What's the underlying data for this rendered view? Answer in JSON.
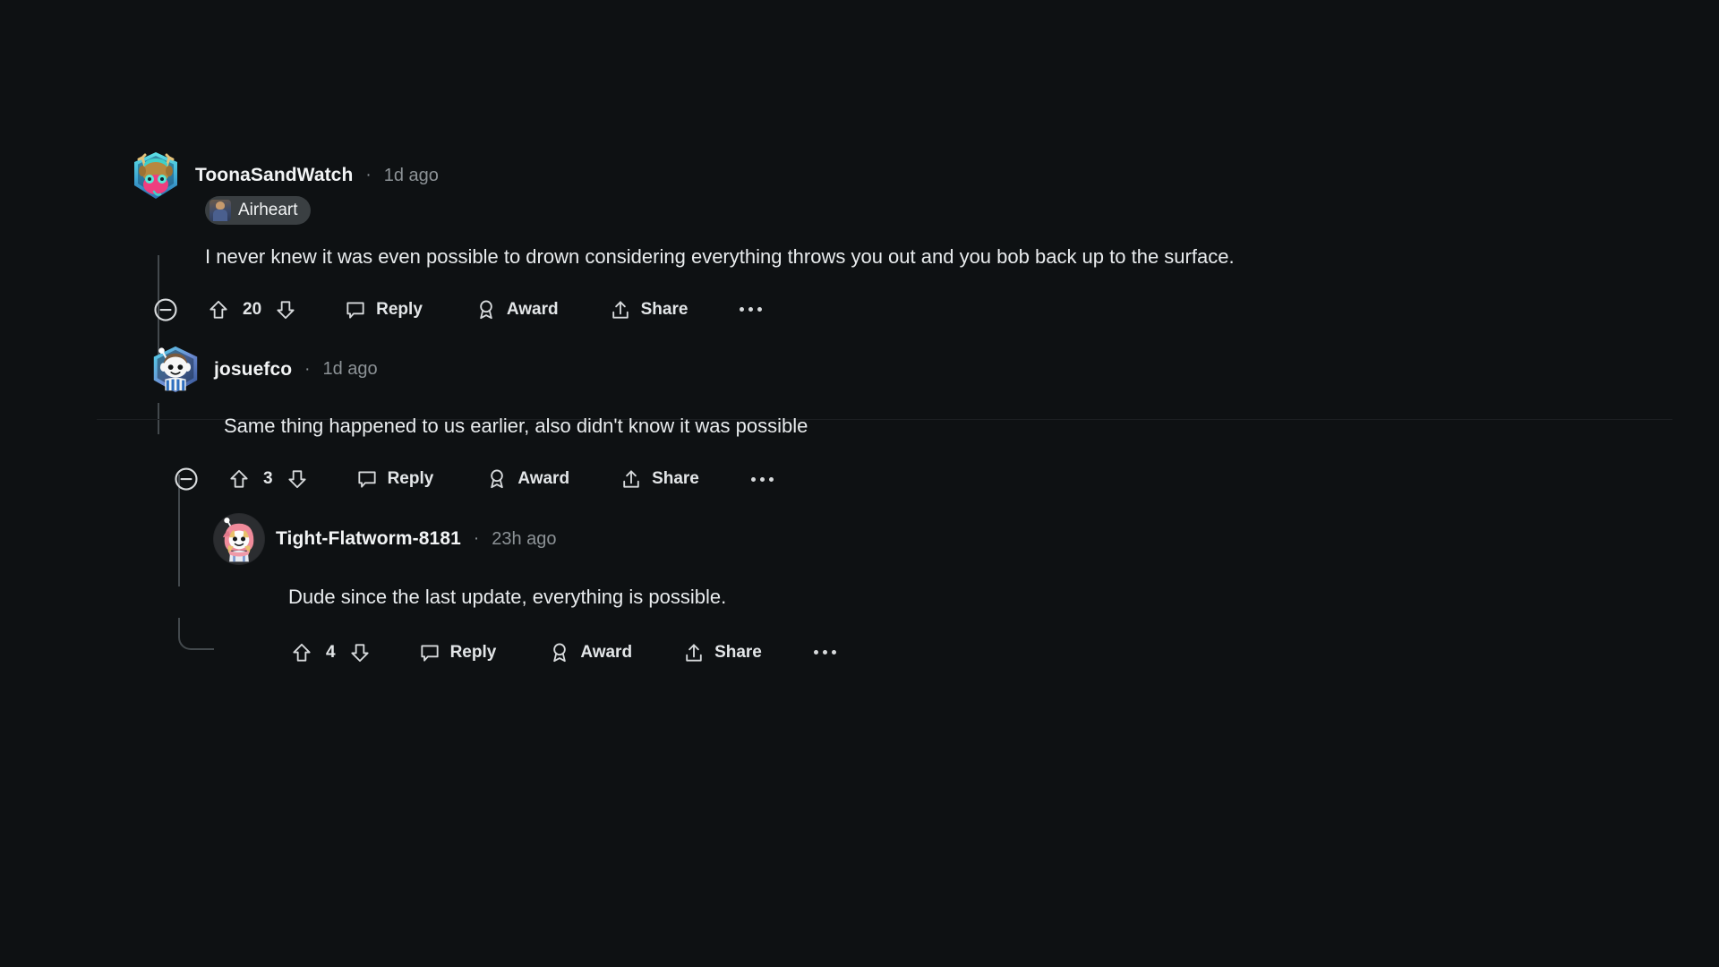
{
  "theme": {
    "background": "#0e1113",
    "text_primary": "#e9ecee",
    "text_muted": "#8c9296",
    "threadline": "#43494d",
    "flair_background": "#3a3f42"
  },
  "comments": [
    {
      "id": "comment-1",
      "username": "ToonaSandWatch",
      "separator": "·",
      "timestamp": "1d ago",
      "flair": {
        "label": "Airheart",
        "icon": "user-flair-icon"
      },
      "body": "I never knew it was even possible to drown considering everything throws you out and you bob back up to the surface.",
      "score": "20",
      "actions": {
        "collapse": "collapse",
        "upvote": "upvote",
        "downvote": "downvote",
        "reply": "Reply",
        "award": "Award",
        "share": "Share",
        "more": "more-options"
      },
      "has_collapse": true,
      "has_more": true
    },
    {
      "id": "comment-2",
      "username": "josuefco",
      "separator": "·",
      "timestamp": "1d ago",
      "flair": null,
      "body": "Same thing happened to us earlier, also didn't know it was possible",
      "score": "3",
      "actions": {
        "collapse": "collapse",
        "upvote": "upvote",
        "downvote": "downvote",
        "reply": "Reply",
        "award": "Award",
        "share": "Share",
        "more": "more-options"
      },
      "has_collapse": true,
      "has_more": true
    },
    {
      "id": "comment-3",
      "username": "Tight-Flatworm-8181",
      "separator": "·",
      "timestamp": "23h ago",
      "flair": null,
      "body": "Dude since the last update, everything is possible.",
      "score": "4",
      "actions": {
        "upvote": "upvote",
        "downvote": "downvote",
        "reply": "Reply",
        "award": "Award",
        "share": "Share",
        "more": "more-options"
      },
      "has_collapse": false,
      "has_more": true
    }
  ]
}
